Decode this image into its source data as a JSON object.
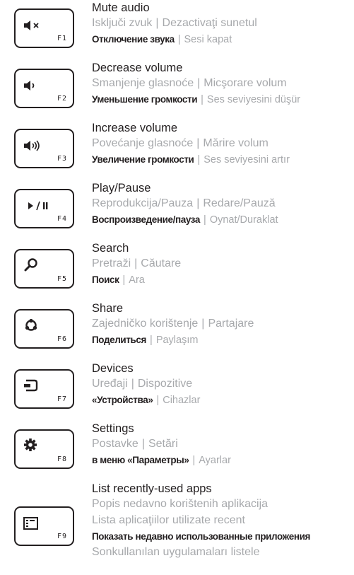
{
  "separator": "|",
  "entries": [
    {
      "key": "F1",
      "icon": "mute-icon",
      "title": "Mute audio",
      "hr": "Isključi zvuk",
      "ro": "Dezactivaţi sunetul",
      "ru": "Отключение звука",
      "tr": "Sesi kapat"
    },
    {
      "key": "F2",
      "icon": "volume-down-icon",
      "title": "Decrease volume",
      "hr": "Smanjenje glasnoće",
      "ro": "Micşorare volum",
      "ru": "Уменьшение громкости",
      "tr": "Ses seviyesini düşür"
    },
    {
      "key": "F3",
      "icon": "volume-up-icon",
      "title": "Increase volume",
      "hr": "Povećanje glasnoće",
      "ro": "Mărire volum",
      "ru": "Увеличение громкости",
      "tr": "Ses seviyesini artır"
    },
    {
      "key": "F4",
      "icon": "play-pause-icon",
      "title": "Play/Pause",
      "hr": "Reprodukcija/Pauza",
      "ro": "Redare/Pauză",
      "ru": "Воспроизведение/пауза",
      "tr": "Oynat/Duraklat"
    },
    {
      "key": "F5",
      "icon": "search-icon",
      "title": "Search",
      "hr": "Pretraži",
      "ro": "Căutare",
      "ru": "Поиск",
      "tr": "Ara"
    },
    {
      "key": "F6",
      "icon": "share-icon",
      "title": "Share",
      "hr": "Zajedničko korištenje",
      "ro": "Partajare",
      "ru": "Поделиться",
      "tr": "Paylaşım"
    },
    {
      "key": "F7",
      "icon": "devices-icon",
      "title": "Devices",
      "hr": "Uređaji",
      "ro": "Dispozitive",
      "ru": "«Устройства»",
      "tr": "Cihazlar"
    },
    {
      "key": "F8",
      "icon": "gear-icon",
      "title": "Settings",
      "hr": "Postavke",
      "ro": "Setări",
      "ru": "в меню «Параметры»",
      "tr": "Ayarlar"
    }
  ],
  "last": {
    "key": "F9",
    "icon": "recent-apps-icon",
    "title": "List recently-used apps",
    "hr": "Popis nedavno korištenih aplikacija",
    "ro": "Lista aplicaţiilor utilizate recent",
    "ru": "Показать недавно использованные приложения",
    "tr": "Sonkullanılan uygulamaları listele"
  }
}
